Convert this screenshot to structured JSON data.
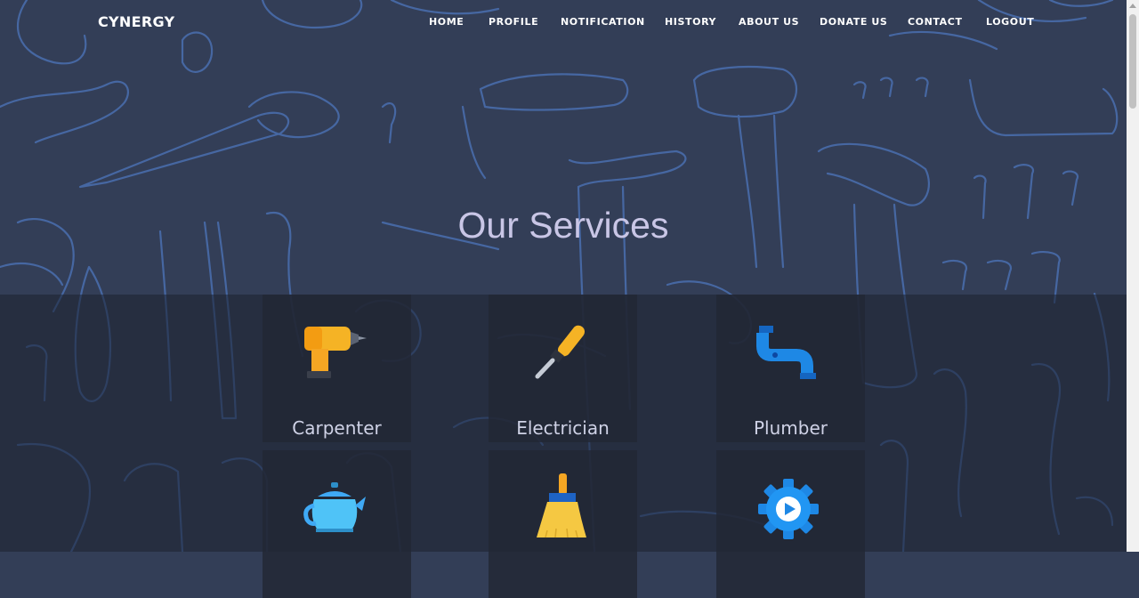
{
  "nav": {
    "brand": "CYNERGY",
    "links": [
      "HOME",
      "PROFILE",
      "NOTIFICATION",
      "HISTORY",
      "ABOUT US",
      "DONATE US",
      "CONTACT",
      "LOGOUT"
    ]
  },
  "main": {
    "heading": "Our Services",
    "services": [
      {
        "label": "Carpenter",
        "icon": "drill-icon"
      },
      {
        "label": "Electrician",
        "icon": "screwdriver-icon"
      },
      {
        "label": "Plumber",
        "icon": "pipe-icon"
      },
      {
        "label": "",
        "icon": "kettle-icon"
      },
      {
        "label": "",
        "icon": "paint-brush-icon"
      },
      {
        "label": "",
        "icon": "gear-icon"
      }
    ]
  },
  "colors": {
    "background": "#333e57",
    "sketch_lines": "#4a6fb0",
    "heading": "#c9c6e6",
    "card": "#222734",
    "accent_yellow": "#f5a623",
    "accent_blue": "#1e88e5"
  }
}
